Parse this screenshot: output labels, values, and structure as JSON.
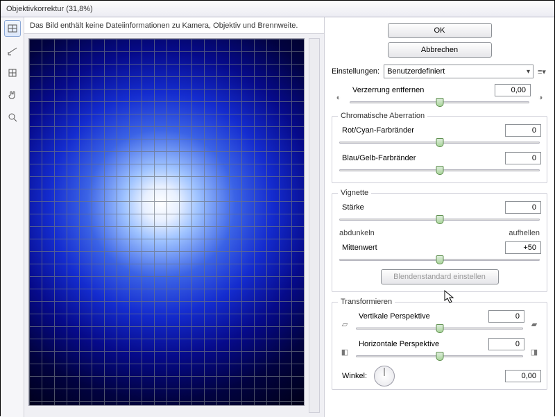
{
  "window": {
    "title": "Objektivkorrektur (31,8%)"
  },
  "info": {
    "message": "Das Bild enthält keine Dateiinformationen zu Kamera, Objektiv und Brennweite."
  },
  "buttons": {
    "ok": "OK",
    "cancel": "Abbrechen"
  },
  "settings": {
    "label": "Einstellungen:",
    "value": "Benutzerdefiniert"
  },
  "distortion": {
    "label": "Verzerrung entfernen",
    "value": "0,00",
    "thumb_pct": 50
  },
  "chromatic": {
    "legend": "Chromatische Aberration",
    "red": {
      "label": "Rot/Cyan-Farbränder",
      "value": "0",
      "thumb_pct": 50
    },
    "blue": {
      "label": "Blau/Gelb-Farbränder",
      "value": "0",
      "thumb_pct": 50
    }
  },
  "vignette": {
    "legend": "Vignette",
    "amount": {
      "label": "Stärke",
      "value": "0",
      "thumb_pct": 50
    },
    "sublabels": {
      "dark": "abdunkeln",
      "light": "aufhellen"
    },
    "mid": {
      "label": "Mittenwert",
      "value": "+50",
      "thumb_pct": 50
    },
    "reset": "Blendenstandard einstellen"
  },
  "transform": {
    "legend": "Transformieren",
    "vpersp": {
      "label": "Vertikale Perspektive",
      "value": "0",
      "thumb_pct": 50
    },
    "hpersp": {
      "label": "Horizontale Perspektive",
      "value": "0",
      "thumb_pct": 50
    },
    "angle": {
      "label": "Winkel:",
      "value": "0,00"
    }
  },
  "icons": {
    "barrel": "◐",
    "pincushion": "◑",
    "menu": "≡▾",
    "persp_l1": "▱",
    "persp_r1": "▰",
    "persp_l2": "◧",
    "persp_r2": "◨"
  }
}
